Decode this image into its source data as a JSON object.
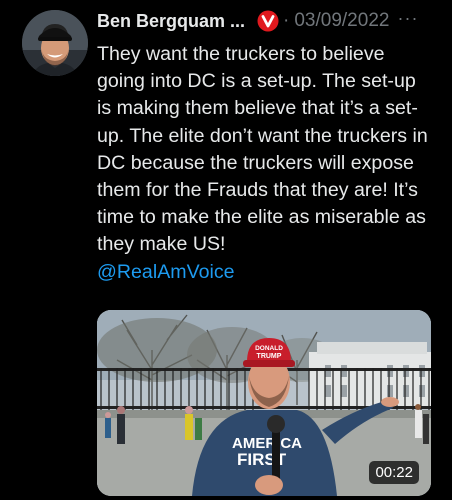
{
  "author": {
    "name": "Ben Bergquam ...",
    "badge_letter": "V",
    "separator": "·",
    "date": "03/09/2022",
    "more_glyph": "···"
  },
  "tweet": {
    "text": "They want the truckers to believe going into DC is a set-up. The set-up is making them believe that it’s a set-up. The elite don’t want the truckers in DC because the truckers will expose them for the Frauds that they are! It’s time to make the elite as miserable as they make US!",
    "mention": "@RealAmVoice"
  },
  "media": {
    "duration": "00:22",
    "hat_text_line1": "DONALD",
    "hat_text_line2": "TRUMP",
    "shirt_text_line1": "AMERICA",
    "shirt_text_line2": "FIRST"
  },
  "colors": {
    "background": "#000000",
    "text": "#e7e9ea",
    "secondary": "#71767b",
    "link": "#1d9bf0",
    "badge": "#e0191e"
  }
}
